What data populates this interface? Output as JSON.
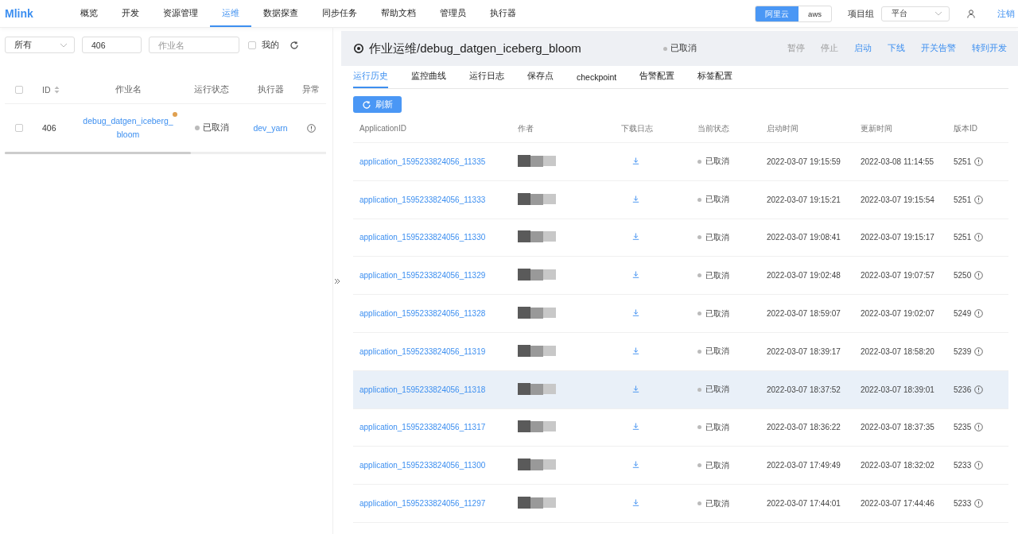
{
  "nav": {
    "logo": "Mlink",
    "items": [
      {
        "label": "概览",
        "selected": false
      },
      {
        "label": "开发",
        "selected": false
      },
      {
        "label": "资源管理",
        "selected": false
      },
      {
        "label": "运维",
        "selected": true
      },
      {
        "label": "数据探查",
        "selected": false
      },
      {
        "label": "同步任务",
        "selected": false
      },
      {
        "label": "帮助文档",
        "selected": false
      },
      {
        "label": "管理员",
        "selected": false
      },
      {
        "label": "执行器",
        "selected": false
      }
    ],
    "clouds": [
      {
        "label": "阿里云",
        "selected": true
      },
      {
        "label": "aws",
        "selected": false
      }
    ],
    "project_label": "项目组",
    "project": "平台",
    "logout": "注销"
  },
  "job_list": {
    "filters": {
      "scope": "所有",
      "id": "406",
      "name_placeholder": "作业名",
      "mine": {
        "label": "我的",
        "checked": false
      }
    },
    "select_all": {
      "checked": false
    },
    "columns": [
      "ID",
      "作业名",
      "运行状态",
      "执行器",
      "异常"
    ],
    "rows": [
      {
        "id": "406",
        "name": "debug_datgen_iceberg_bloom",
        "status": "已取消",
        "executor": "dev_yarn",
        "checked": false,
        "flagged": true
      }
    ]
  },
  "detail": {
    "title": "作业运维/debug_datgen_iceberg_bloom",
    "status": "已取消",
    "actions": [
      {
        "label": "暂停",
        "disabled": true
      },
      {
        "label": "停止",
        "disabled": true
      },
      {
        "label": "启动",
        "disabled": false
      },
      {
        "label": "下线",
        "disabled": false
      },
      {
        "label": "开关告警",
        "disabled": false
      },
      {
        "label": "转到开发",
        "disabled": false
      }
    ],
    "tabs": [
      {
        "label": "运行历史",
        "selected": true
      },
      {
        "label": "监控曲线",
        "selected": false
      },
      {
        "label": "运行日志",
        "selected": false
      },
      {
        "label": "保存点",
        "selected": false
      },
      {
        "label": "checkpoint",
        "selected": false
      },
      {
        "label": "告警配置",
        "selected": false
      },
      {
        "label": "标签配置",
        "selected": false
      }
    ],
    "refresh": "刷新",
    "columns": [
      "ApplicationID",
      "作者",
      "下载日志",
      "当前状态",
      "启动时间",
      "更新时间",
      "版本ID"
    ],
    "rows": [
      {
        "app_id": "application_1595233824056_11335",
        "status": "已取消",
        "start": "2022-03-07 19:15:59",
        "update": "2022-03-08 11:14:55",
        "version": "5251",
        "highlighted": false
      },
      {
        "app_id": "application_1595233824056_11333",
        "status": "已取消",
        "start": "2022-03-07 19:15:21",
        "update": "2022-03-07 19:15:54",
        "version": "5251",
        "highlighted": false
      },
      {
        "app_id": "application_1595233824056_11330",
        "status": "已取消",
        "start": "2022-03-07 19:08:41",
        "update": "2022-03-07 19:15:17",
        "version": "5251",
        "highlighted": false
      },
      {
        "app_id": "application_1595233824056_11329",
        "status": "已取消",
        "start": "2022-03-07 19:02:48",
        "update": "2022-03-07 19:07:57",
        "version": "5250",
        "highlighted": false
      },
      {
        "app_id": "application_1595233824056_11328",
        "status": "已取消",
        "start": "2022-03-07 18:59:07",
        "update": "2022-03-07 19:02:07",
        "version": "5249",
        "highlighted": false
      },
      {
        "app_id": "application_1595233824056_11319",
        "status": "已取消",
        "start": "2022-03-07 18:39:17",
        "update": "2022-03-07 18:58:20",
        "version": "5239",
        "highlighted": false
      },
      {
        "app_id": "application_1595233824056_11318",
        "status": "已取消",
        "start": "2022-03-07 18:37:52",
        "update": "2022-03-07 18:39:01",
        "version": "5236",
        "highlighted": true
      },
      {
        "app_id": "application_1595233824056_11317",
        "status": "已取消",
        "start": "2022-03-07 18:36:22",
        "update": "2022-03-07 18:37:35",
        "version": "5235",
        "highlighted": false
      },
      {
        "app_id": "application_1595233824056_11300",
        "status": "已取消",
        "start": "2022-03-07 17:49:49",
        "update": "2022-03-07 18:32:02",
        "version": "5233",
        "highlighted": false
      },
      {
        "app_id": "application_1595233824056_11297",
        "status": "已取消",
        "start": "2022-03-07 17:44:01",
        "update": "2022-03-07 17:44:46",
        "version": "5233",
        "highlighted": false
      }
    ]
  }
}
